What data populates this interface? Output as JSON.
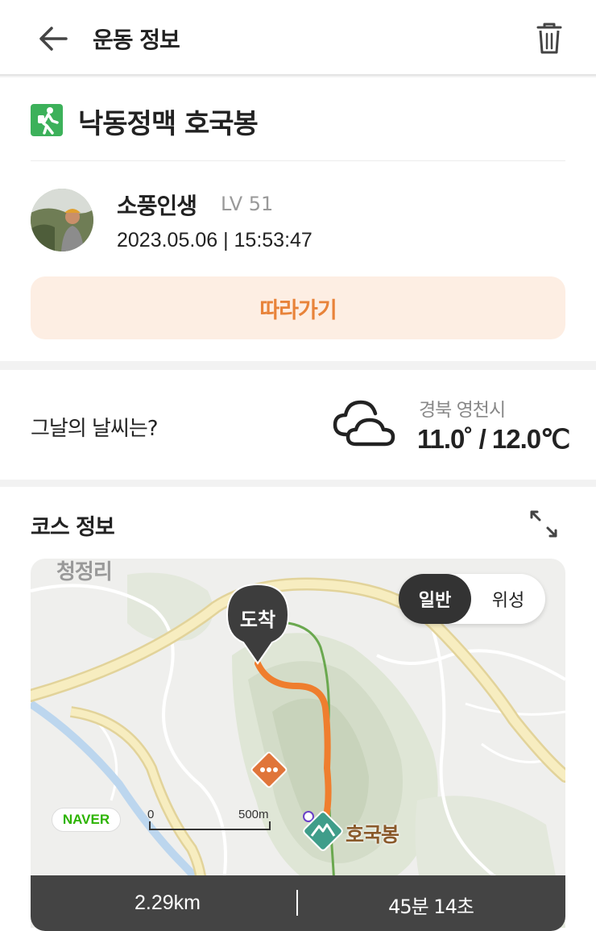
{
  "header": {
    "title": "운동 정보",
    "back_icon": "arrow-left-icon",
    "delete_icon": "trash-icon"
  },
  "activity": {
    "icon": "hiking-icon",
    "title": "낙동정맥 호국봉"
  },
  "user": {
    "name": "소풍인생",
    "level": "LV 51",
    "datetime": "2023.05.06 | 15:53:47"
  },
  "follow_button": {
    "label": "따라가기"
  },
  "weather": {
    "label": "그날의 날씨는?",
    "icon": "cloud-icon",
    "location": "경북 영천시",
    "temperature": "11.0˚ / 12.0℃"
  },
  "course": {
    "label": "코스 정보",
    "expand_icon": "expand-icon",
    "map": {
      "place_label": "청정리",
      "toggle": {
        "normal": "일반",
        "satellite": "위성",
        "selected": "일반"
      },
      "arrival_label": "도착",
      "provider": "NAVER",
      "scale_zero": "0",
      "scale_max": "500m",
      "peak_label": "호국봉"
    },
    "distance": "2.29km",
    "duration": "45분 14초"
  },
  "colors": {
    "accent": "#e8833a",
    "accent_light": "#fdeee3",
    "route": "#ef7e2e",
    "trail": "#6aa84f",
    "road": "#f5e9b5",
    "naver": "#2db400"
  }
}
